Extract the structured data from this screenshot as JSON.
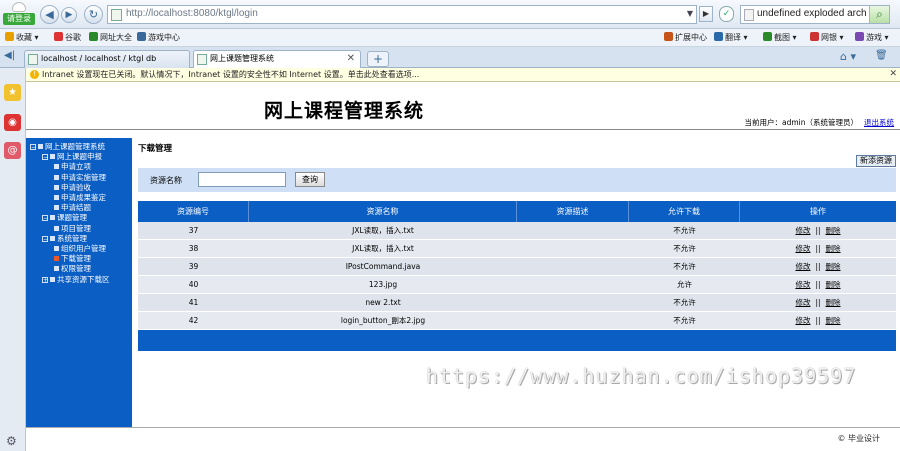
{
  "browser": {
    "login_label": "请登录",
    "url": "http://localhost:8080/ktgl/login",
    "search_text": "undefined exploded archi",
    "favorites": [
      {
        "label": "收藏",
        "color": "#e8a000"
      },
      {
        "label": "谷歌",
        "color": "#d33"
      },
      {
        "label": "网址大全",
        "color": "#2a8a2a"
      },
      {
        "label": "游戏中心",
        "color": "#3a6a9a"
      }
    ],
    "extras": [
      {
        "label": "扩展中心",
        "color": "#c5531a"
      },
      {
        "label": "翻译",
        "color": "#2a6aa8"
      },
      {
        "label": "截图",
        "color": "#2a8a2a"
      },
      {
        "label": "网银",
        "color": "#c33"
      },
      {
        "label": "游戏",
        "color": "#7a4ab0"
      }
    ],
    "tabs": [
      {
        "label": "localhost / localhost / ktgl db",
        "active": false
      },
      {
        "label": "网上课题管理系统",
        "active": true
      }
    ],
    "infobar": "Intranet 设置现在已关闭。默认情况下，Intranet 设置的安全性不如 Internet 设置。单击此处查看选项..."
  },
  "page": {
    "title": "网上课程管理系统",
    "current_user_text": "当前用户：admin（系统管理员）",
    "logout_label": "退出系统",
    "tree": [
      {
        "label": "网上课题管理系统",
        "level": 0,
        "box": "−"
      },
      {
        "label": "网上课题申报",
        "level": 1,
        "box": "−"
      },
      {
        "label": "申请立项",
        "level": 2
      },
      {
        "label": "申请实施管理",
        "level": 2
      },
      {
        "label": "申请验收",
        "level": 2
      },
      {
        "label": "申请成果鉴定",
        "level": 2
      },
      {
        "label": "申请结题",
        "level": 2
      },
      {
        "label": "课题管理",
        "level": 1,
        "box": "−"
      },
      {
        "label": "项目管理",
        "level": 2
      },
      {
        "label": "系统管理",
        "level": 1,
        "box": "−"
      },
      {
        "label": "组织用户管理",
        "level": 2
      },
      {
        "label": "下载管理",
        "level": 2,
        "current": true
      },
      {
        "label": "权限管理",
        "level": 2
      },
      {
        "label": "共享资源下载区",
        "level": 1,
        "box": "+"
      }
    ],
    "section_title": "下载管理",
    "add_button": "新添资源",
    "search_label": "资源名称",
    "search_value": "",
    "search_button": "查询",
    "table": {
      "headers": [
        "资源编号",
        "资源名称",
        "资源描述",
        "允许下载",
        "操作"
      ],
      "rows": [
        {
          "id": "37",
          "name": "JXL读取，插入.txt",
          "desc": "",
          "allow": "不允许"
        },
        {
          "id": "38",
          "name": "JXL读取，插入.txt",
          "desc": "",
          "allow": "不允许"
        },
        {
          "id": "39",
          "name": "IPostCommand.java",
          "desc": "",
          "allow": "不允许"
        },
        {
          "id": "40",
          "name": "123.jpg",
          "desc": "",
          "allow": "允许"
        },
        {
          "id": "41",
          "name": "new 2.txt",
          "desc": "",
          "allow": "不允许"
        },
        {
          "id": "42",
          "name": "login_button_副本2.jpg",
          "desc": "",
          "allow": "不允许"
        }
      ],
      "edit_label": "修改",
      "separator": "||",
      "delete_label": "删除"
    },
    "footer": "© 毕业设计",
    "watermark": "https://www.huzhan.com/ishop39597"
  }
}
